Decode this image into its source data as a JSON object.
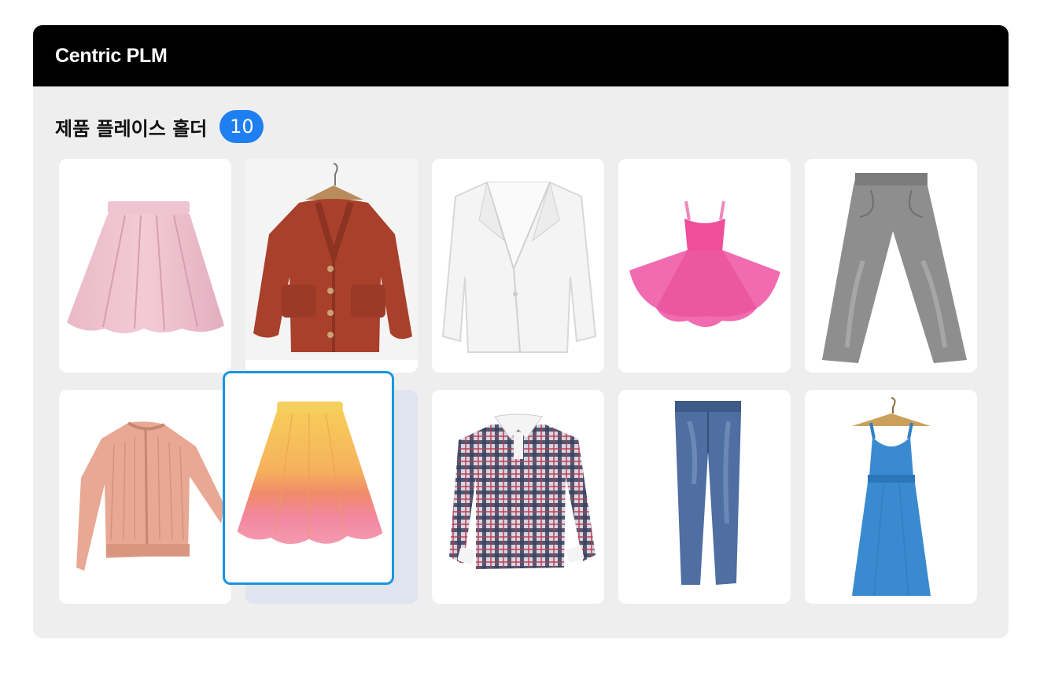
{
  "app": {
    "title": "Centric PLM"
  },
  "section": {
    "title": "제품 플레이스 홀더",
    "count": "10"
  },
  "products": [
    {
      "icon": "pink-pleated-skirt-icon",
      "selected": false
    },
    {
      "icon": "rust-knit-cardigan-icon",
      "selected": false
    },
    {
      "icon": "white-blazer-icon",
      "selected": false
    },
    {
      "icon": "pink-tulle-dress-icon",
      "selected": false
    },
    {
      "icon": "grey-jeans-icon",
      "selected": false
    },
    {
      "icon": "peach-velvet-bomber-icon",
      "selected": false
    },
    {
      "icon": "ombre-midi-skirt-icon",
      "selected": true
    },
    {
      "icon": "plaid-polo-shirt-icon",
      "selected": false
    },
    {
      "icon": "blue-jeans-icon",
      "selected": false
    },
    {
      "icon": "blue-sundress-icon",
      "selected": false
    }
  ],
  "colors": {
    "accent": "#1f7ff0",
    "selection_border": "#1a95e0",
    "header_bg": "#000000",
    "panel_bg": "#eeeeee"
  }
}
